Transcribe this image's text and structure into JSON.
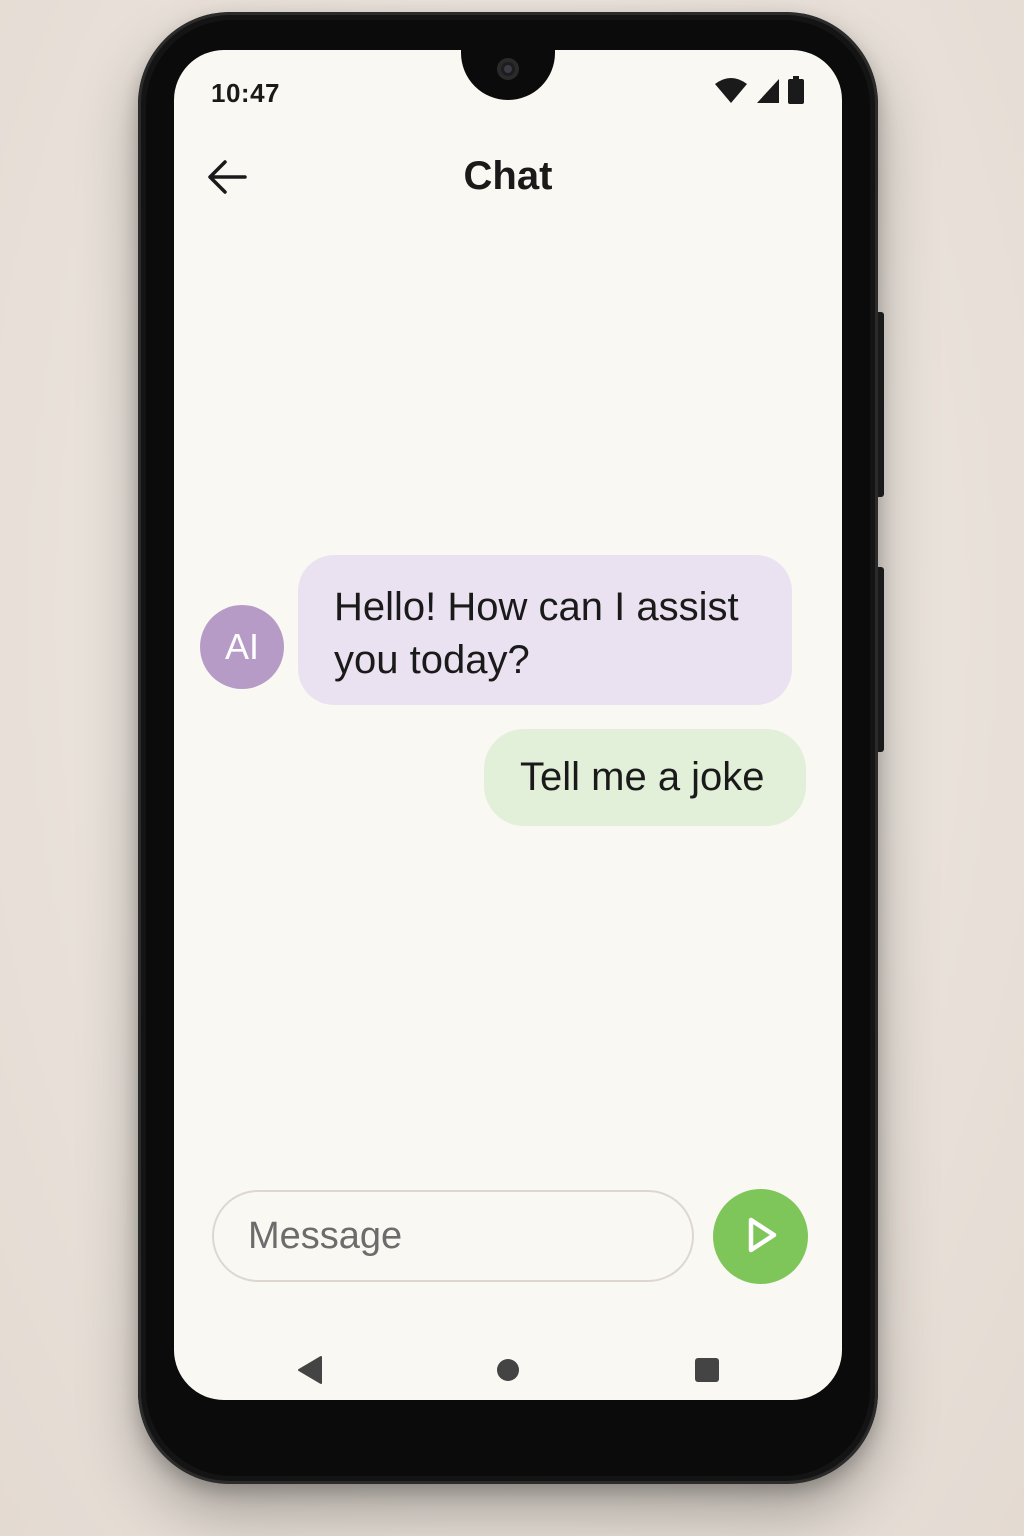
{
  "status_bar": {
    "time": "10:47",
    "icons": [
      "wifi-icon",
      "cellular-signal-icon",
      "battery-icon"
    ]
  },
  "header": {
    "back_icon": "arrow-left-icon",
    "title": "Chat"
  },
  "messages": [
    {
      "sender": "ai",
      "avatar_label": "AI",
      "text": "Hello! How can I assist you today?"
    },
    {
      "sender": "user",
      "text": "Tell me a joke"
    }
  ],
  "composer": {
    "value": "",
    "placeholder": "Message",
    "send_icon": "send-play-icon"
  },
  "navigation_bar": {
    "items": [
      "nav-back-icon",
      "nav-home-icon",
      "nav-recents-icon"
    ]
  },
  "colors": {
    "screen_background": "#faf8f3",
    "ai_bubble": "#ebe2f1",
    "ai_avatar": "#b79bc7",
    "user_bubble": "#e3f0d9",
    "send_button": "#7fc65a"
  }
}
